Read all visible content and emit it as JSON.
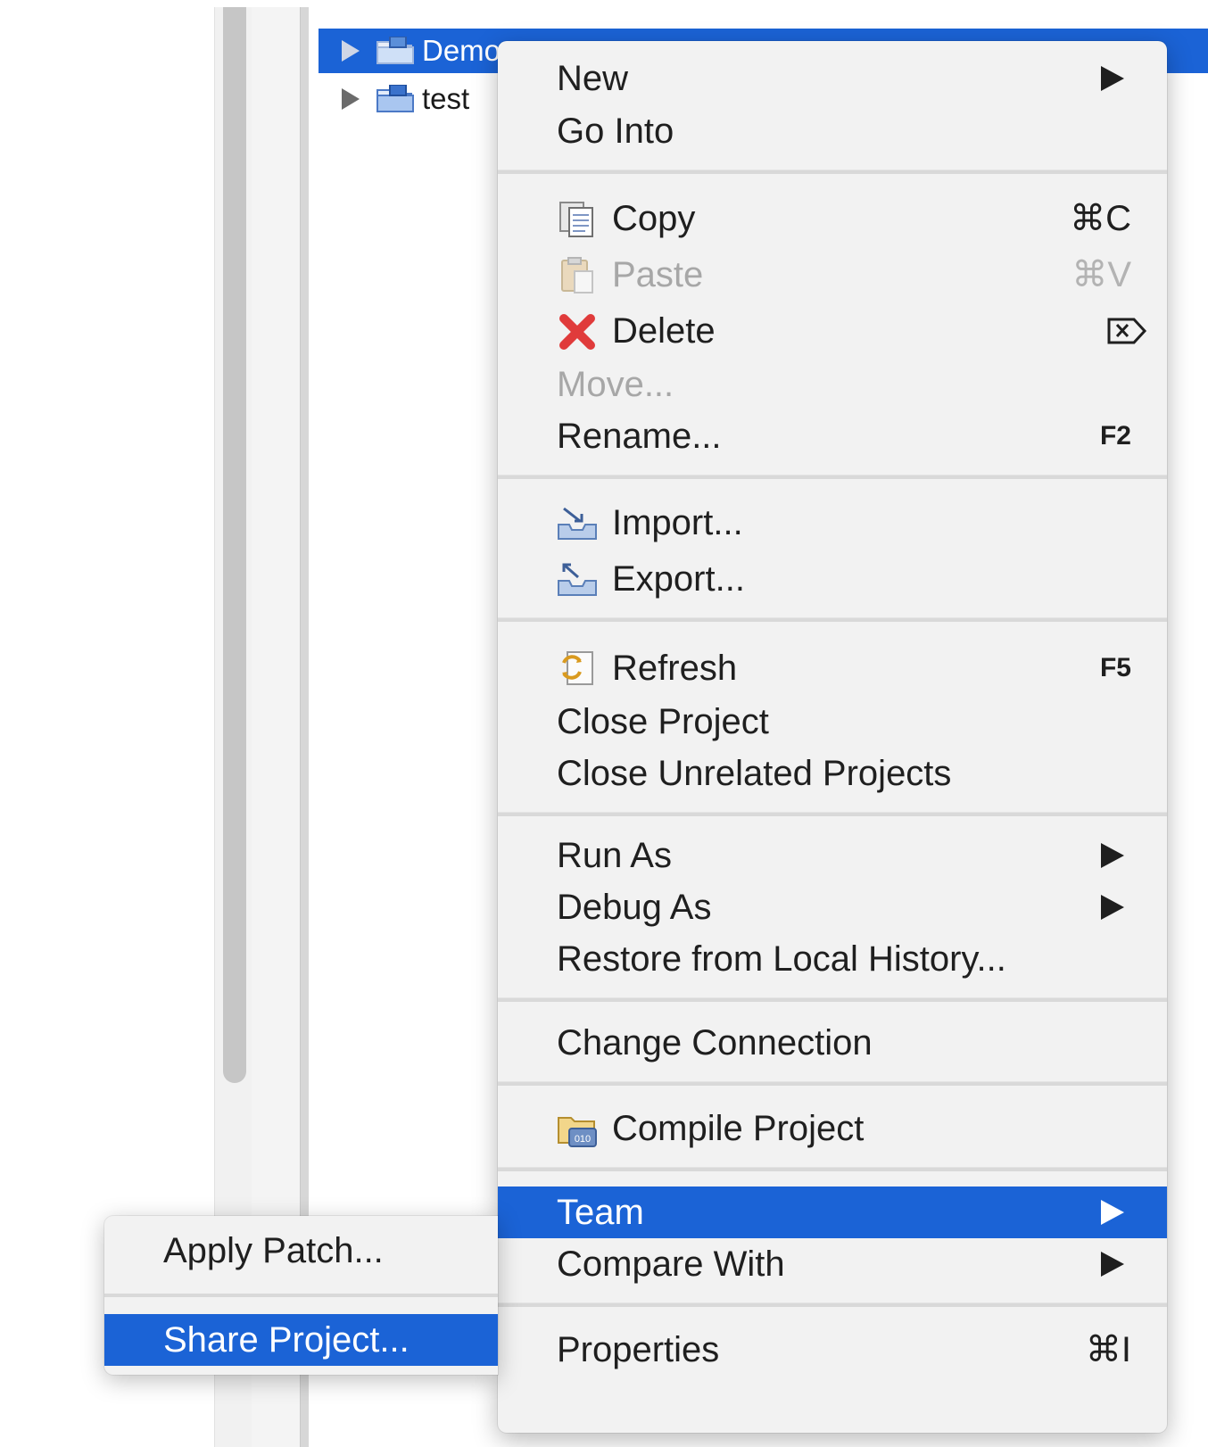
{
  "project_tree": {
    "items": [
      {
        "label": "Demo",
        "selected": true
      },
      {
        "label": "test",
        "selected": false
      }
    ]
  },
  "context_menu": {
    "new": {
      "label": "New"
    },
    "go_into": {
      "label": "Go Into"
    },
    "copy": {
      "label": "Copy",
      "shortcut": "⌘C",
      "icon": "copy-icon"
    },
    "paste": {
      "label": "Paste",
      "shortcut": "⌘V",
      "icon": "paste-icon",
      "disabled": true
    },
    "delete": {
      "label": "Delete",
      "shortcut": "⌦",
      "icon": "delete-icon"
    },
    "move": {
      "label": "Move...",
      "disabled": true
    },
    "rename": {
      "label": "Rename...",
      "shortcut": "F2"
    },
    "import": {
      "label": "Import...",
      "icon": "import-icon"
    },
    "export": {
      "label": "Export...",
      "icon": "export-icon"
    },
    "refresh": {
      "label": "Refresh",
      "shortcut": "F5",
      "icon": "refresh-icon"
    },
    "close_project": {
      "label": "Close Project"
    },
    "close_unrelated": {
      "label": "Close Unrelated Projects"
    },
    "run_as": {
      "label": "Run As"
    },
    "debug_as": {
      "label": "Debug As"
    },
    "restore_history": {
      "label": "Restore from Local History..."
    },
    "change_connection": {
      "label": "Change Connection"
    },
    "compile_project": {
      "label": "Compile Project",
      "icon": "compile-icon"
    },
    "team": {
      "label": "Team",
      "highlighted": true
    },
    "compare_with": {
      "label": "Compare With"
    },
    "properties": {
      "label": "Properties",
      "shortcut": "⌘I"
    }
  },
  "team_submenu": {
    "apply_patch": {
      "label": "Apply Patch..."
    },
    "share_project": {
      "label": "Share Project...",
      "highlighted": true
    }
  },
  "colors": {
    "selection": "#1b63d6",
    "menu_background": "#f2f2f2",
    "disabled_text": "#a7a7a7"
  }
}
